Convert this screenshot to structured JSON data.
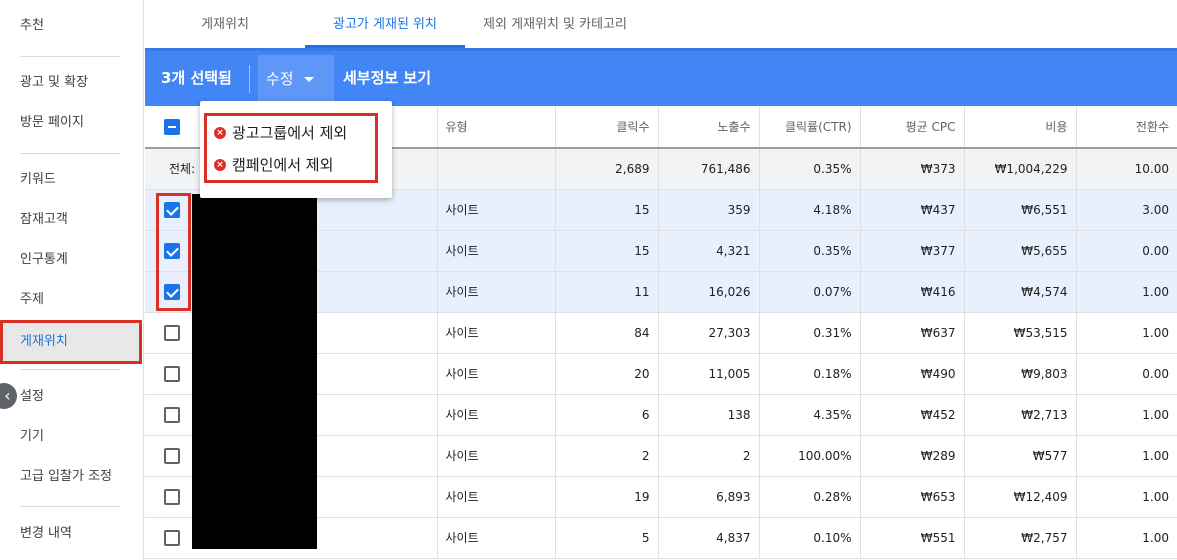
{
  "sidebar": {
    "items": [
      {
        "label": "추천",
        "active": false
      },
      {
        "label": "광고 및 확장",
        "active": false
      },
      {
        "label": "방문 페이지",
        "active": false
      },
      {
        "label": "키워드",
        "active": false
      },
      {
        "label": "잠재고객",
        "active": false
      },
      {
        "label": "인구통계",
        "active": false
      },
      {
        "label": "주제",
        "active": false
      },
      {
        "label": "게재위치",
        "active": true
      },
      {
        "label": "설정",
        "active": false
      },
      {
        "label": "기기",
        "active": false
      },
      {
        "label": "고급 입찰가 조정",
        "active": false
      },
      {
        "label": "변경 내역",
        "active": false
      }
    ],
    "collapse_glyph": "‹"
  },
  "tabs": [
    {
      "label": "게재위치",
      "active": false
    },
    {
      "label": "광고가 게재된 위치",
      "active": true
    },
    {
      "label": "제외 게재위치 및 카테고리",
      "active": false
    }
  ],
  "selection_bar": {
    "count_label": "3개 선택됨",
    "edit_label": "수정",
    "details_label": "세부정보 보기"
  },
  "menu": {
    "items": [
      {
        "label": "광고그룹에서 제외",
        "icon": "remove-circle-icon"
      },
      {
        "label": "캠페인에서 제외",
        "icon": "remove-circle-icon"
      }
    ],
    "icon_glyph": "×"
  },
  "table": {
    "columns": [
      "",
      "",
      "유형",
      "클릭수",
      "노출수",
      "클릭률(CTR)",
      "평균 CPC",
      "비용",
      "전환수"
    ],
    "total": {
      "label": "전체:",
      "type": "",
      "clicks": "2,689",
      "impressions": "761,486",
      "ctr": "0.35%",
      "cpc": "₩373",
      "cost": "₩1,004,229",
      "conversions": "10.00"
    },
    "rows": [
      {
        "selected": true,
        "type": "사이트",
        "clicks": "15",
        "impressions": "359",
        "ctr": "4.18%",
        "cpc": "₩437",
        "cost": "₩6,551",
        "conversions": "3.00"
      },
      {
        "selected": true,
        "type": "사이트",
        "clicks": "15",
        "impressions": "4,321",
        "ctr": "0.35%",
        "cpc": "₩377",
        "cost": "₩5,655",
        "conversions": "0.00"
      },
      {
        "selected": true,
        "type": "사이트",
        "clicks": "11",
        "impressions": "16,026",
        "ctr": "0.07%",
        "cpc": "₩416",
        "cost": "₩4,574",
        "conversions": "1.00"
      },
      {
        "selected": false,
        "type": "사이트",
        "clicks": "84",
        "impressions": "27,303",
        "ctr": "0.31%",
        "cpc": "₩637",
        "cost": "₩53,515",
        "conversions": "1.00"
      },
      {
        "selected": false,
        "type": "사이트",
        "clicks": "20",
        "impressions": "11,005",
        "ctr": "0.18%",
        "cpc": "₩490",
        "cost": "₩9,803",
        "conversions": "0.00"
      },
      {
        "selected": false,
        "type": "사이트",
        "clicks": "6",
        "impressions": "138",
        "ctr": "4.35%",
        "cpc": "₩452",
        "cost": "₩2,713",
        "conversions": "1.00"
      },
      {
        "selected": false,
        "type": "사이트",
        "clicks": "2",
        "impressions": "2",
        "ctr": "100.00%",
        "cpc": "₩289",
        "cost": "₩577",
        "conversions": "1.00"
      },
      {
        "selected": false,
        "type": "사이트",
        "clicks": "19",
        "impressions": "6,893",
        "ctr": "0.28%",
        "cpc": "₩653",
        "cost": "₩12,409",
        "conversions": "1.00"
      },
      {
        "selected": false,
        "type": "사이트",
        "clicks": "5",
        "impressions": "4,837",
        "ctr": "0.10%",
        "cpc": "₩551",
        "cost": "₩2,757",
        "conversions": "1.00"
      }
    ]
  },
  "colors": {
    "accent": "#1a73e8",
    "selection_bar": "#4285f4",
    "highlight": "#d93025"
  }
}
